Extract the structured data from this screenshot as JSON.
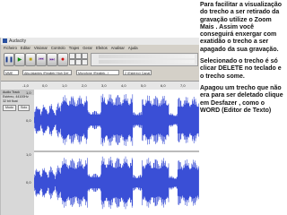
{
  "window": {
    "title": "Audacity"
  },
  "menu": [
    "Ficheiro",
    "Editar",
    "Visionar",
    "Controlo",
    "Trajes",
    "Gerar",
    "Efeitos",
    "Analisar",
    "Ajuda"
  ],
  "devices": {
    "host": "MME",
    "output": "Alto-falantes (Realtek High Def...)",
    "input": "Microfone (Realtek...)",
    "channels": "2 (Estéreo) Canal"
  },
  "ruler": [
    "-1,0",
    "0,0",
    "1,0",
    "2,0",
    "3,0",
    "4,0",
    "5,0",
    "6,0",
    "7,0"
  ],
  "track": {
    "name": "Audio Track",
    "info": [
      "Estéreo, 44100Hz",
      "32 bit float"
    ],
    "mute": "Mudo",
    "solo": "Solo",
    "scale_top": "1,0",
    "scale_mid": "0,0"
  },
  "colors": {
    "wave": "#3a4fd6",
    "track_bg": "#ffffff",
    "panel_bg": "#ffffff"
  },
  "panel": {
    "p1": " Para facilitar a visualização do trecho a ser retirado da gravação utilize o Zoom Mais . Assim você conseguirá enxergar com exatidão o trecho a ser apagado da sua gravação.",
    "p2": "Selecionado o trecho é só clicar DELETE no teclado e o trecho some.",
    "p3": "Apagou um trecho que não era para ser deletado clique em Desfazer , como o WORD (Editor de Texto)"
  }
}
